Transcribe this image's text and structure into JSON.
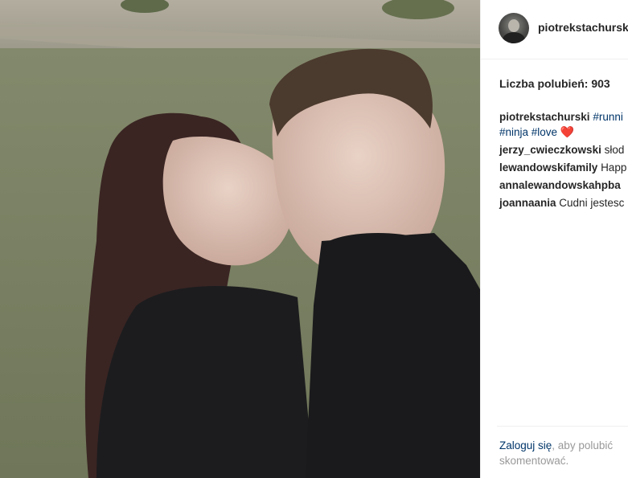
{
  "photo": {
    "description_icon": "photo"
  },
  "header": {
    "username": "piotrekstachurski"
  },
  "likes": {
    "label": "Liczba polubień: 903"
  },
  "caption": {
    "author": "piotrekstachurski",
    "tags_line1": "#runni",
    "tags_line2_a": "#ninja",
    "tags_line2_b": "#love",
    "heart": "❤️"
  },
  "comments": [
    {
      "author": "jerzy_cwieczkowski",
      "text": "słod"
    },
    {
      "author": "lewandowskifamily",
      "text": "Happ"
    },
    {
      "author": "annalewandowskahpba",
      "text": ""
    },
    {
      "author": "joannaania",
      "text": "Cudni jestesc"
    }
  ],
  "footer": {
    "login": "Zaloguj się",
    "text1": ", aby polubić",
    "text2": "skomentować."
  },
  "colors": {
    "link": "#003569",
    "text": "#262626",
    "muted": "#999999"
  }
}
